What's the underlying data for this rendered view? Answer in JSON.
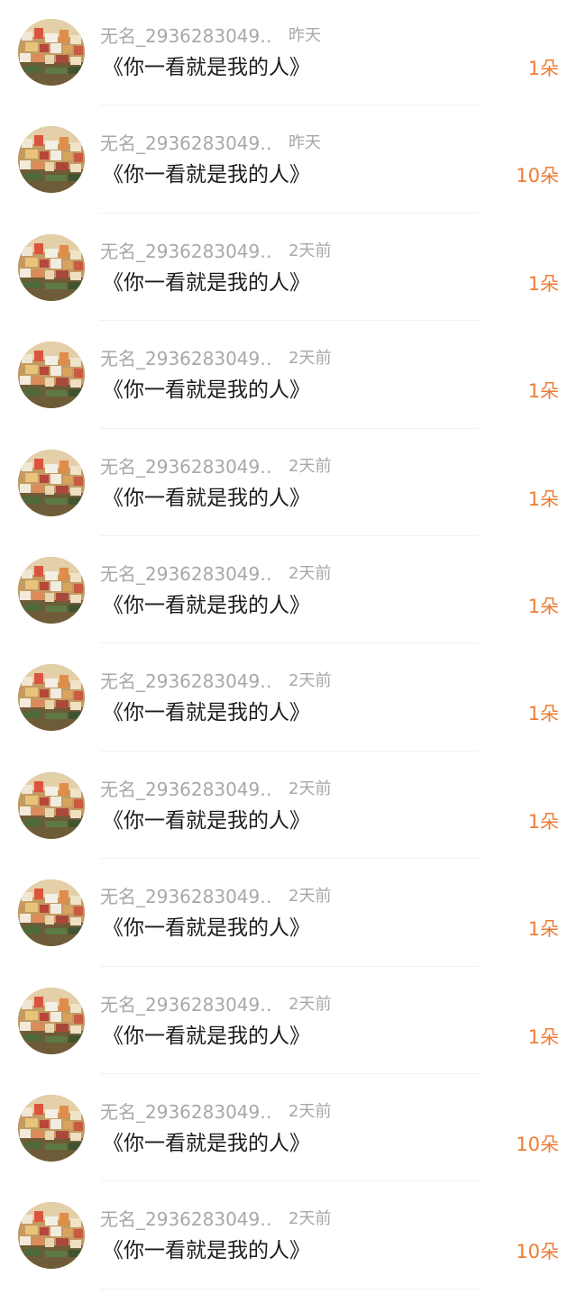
{
  "colors": {
    "username": "#a8a8a8",
    "time": "#a8a8a8",
    "song": "#1c1c1c",
    "count": "#ee7d35",
    "divider": "#f1f1f1"
  },
  "gifts": [
    {
      "avatar": "user-avatar-photo",
      "username": "无名_2936283049…",
      "time": "昨天",
      "song": "《你一看就是我的人》",
      "count": "1朵"
    },
    {
      "avatar": "user-avatar-photo",
      "username": "无名_2936283049…",
      "time": "昨天",
      "song": "《你一看就是我的人》",
      "count": "10朵"
    },
    {
      "avatar": "user-avatar-photo",
      "username": "无名_2936283049…",
      "time": "2天前",
      "song": "《你一看就是我的人》",
      "count": "1朵"
    },
    {
      "avatar": "user-avatar-photo",
      "username": "无名_2936283049…",
      "time": "2天前",
      "song": "《你一看就是我的人》",
      "count": "1朵"
    },
    {
      "avatar": "user-avatar-photo",
      "username": "无名_2936283049…",
      "time": "2天前",
      "song": "《你一看就是我的人》",
      "count": "1朵"
    },
    {
      "avatar": "user-avatar-photo",
      "username": "无名_2936283049…",
      "time": "2天前",
      "song": "《你一看就是我的人》",
      "count": "1朵"
    },
    {
      "avatar": "user-avatar-photo",
      "username": "无名_2936283049…",
      "time": "2天前",
      "song": "《你一看就是我的人》",
      "count": "1朵"
    },
    {
      "avatar": "user-avatar-photo",
      "username": "无名_2936283049…",
      "time": "2天前",
      "song": "《你一看就是我的人》",
      "count": "1朵"
    },
    {
      "avatar": "user-avatar-photo",
      "username": "无名_2936283049…",
      "time": "2天前",
      "song": "《你一看就是我的人》",
      "count": "1朵"
    },
    {
      "avatar": "user-avatar-photo",
      "username": "无名_2936283049…",
      "time": "2天前",
      "song": "《你一看就是我的人》",
      "count": "1朵"
    },
    {
      "avatar": "user-avatar-photo",
      "username": "无名_2936283049…",
      "time": "2天前",
      "song": "《你一看就是我的人》",
      "count": "10朵"
    },
    {
      "avatar": "user-avatar-photo",
      "username": "无名_2936283049…",
      "time": "2天前",
      "song": "《你一看就是我的人》",
      "count": "10朵"
    }
  ]
}
